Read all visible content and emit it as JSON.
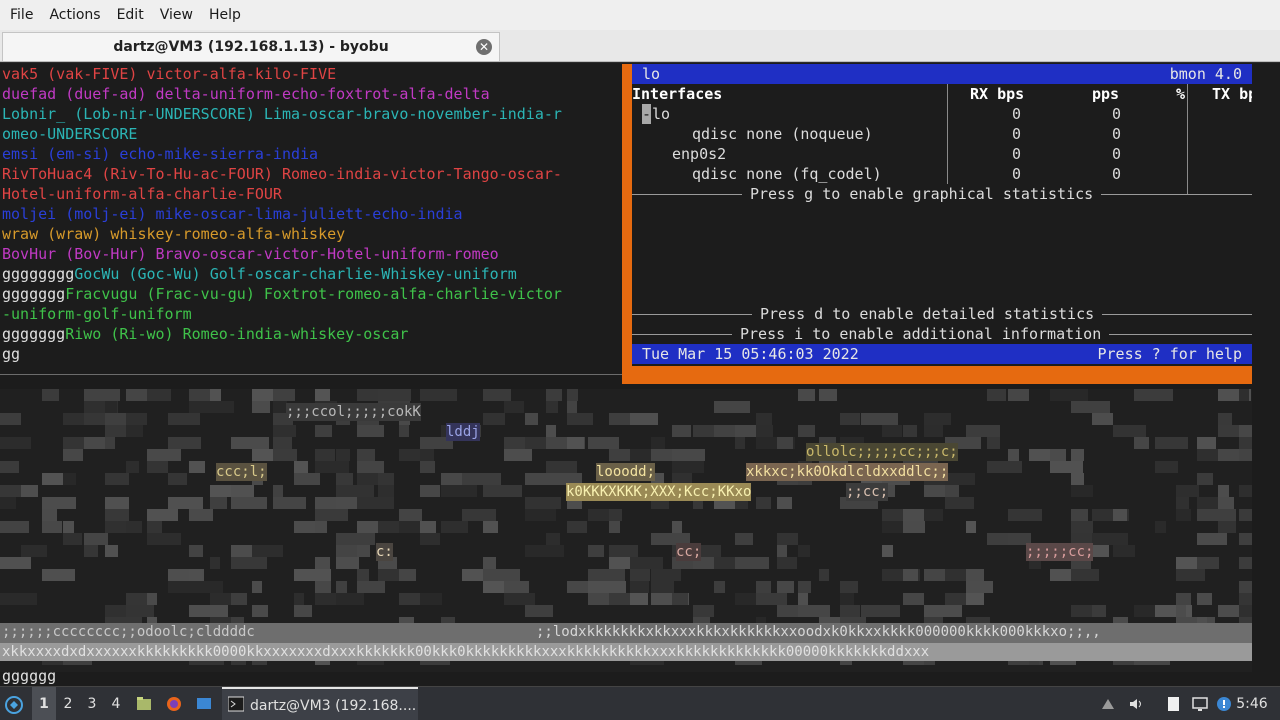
{
  "menubar": {
    "items": [
      "File",
      "Actions",
      "Edit",
      "View",
      "Help"
    ]
  },
  "tab": {
    "title": "dartz@VM3 (192.168.1.13) - byobu",
    "close_glyph": "✕"
  },
  "left_pane": {
    "lines": [
      {
        "text": "vak5 (vak-FIVE) victor-alfa-kilo-FIVE",
        "color": "#e04444"
      },
      {
        "text": "duefad (duef-ad) delta-uniform-echo-foxtrot-alfa-delta",
        "color": "#c13ac4"
      },
      {
        "text": "Lobnir_ (Lob-nir-UNDERSCORE) Lima-oscar-bravo-november-india-r",
        "color": "#2bb5b5"
      },
      {
        "text": "omeo-UNDERSCORE",
        "color": "#2bb5b5"
      },
      {
        "text": "emsi (em-si) echo-mike-sierra-india",
        "color": "#2a3fd8"
      },
      {
        "text": "RivToHuac4 (Riv-To-Hu-ac-FOUR) Romeo-india-victor-Tango-oscar-",
        "color": "#e04444"
      },
      {
        "text": "Hotel-uniform-alfa-charlie-FOUR",
        "color": "#e04444"
      },
      {
        "text": "moljei (molj-ei) mike-oscar-lima-juliett-echo-india",
        "color": "#2a3fd8"
      },
      {
        "text": "wraw (wraw) whiskey-romeo-alfa-whiskey",
        "color": "#d79a2a"
      },
      {
        "text": "BovHur (Bov-Hur) Bravo-oscar-victor-Hotel-uniform-romeo",
        "color": "#c13ac4"
      },
      {
        "text": "ggggggggGocWu (Goc-Wu) Golf-oscar-charlie-Whiskey-uniform",
        "color": "#2bb5b5",
        "prefix": "gggggggg"
      },
      {
        "text": "gggggggFracvugu (Frac-vu-gu) Foxtrot-romeo-alfa-charlie-victor",
        "color": "#3fc24a",
        "prefix": "ggggggg"
      },
      {
        "text": "-uniform-golf-uniform",
        "color": "#3fc24a"
      },
      {
        "text": "gggggggRiwo (Ri-wo) Romeo-india-whiskey-oscar",
        "color": "#3fc24a",
        "prefix": "ggggggg"
      },
      {
        "text": "gg",
        "color": "#e0e0e0"
      }
    ]
  },
  "bmon": {
    "interface_name": "lo",
    "version": "bmon 4.0",
    "columns": [
      "Interfaces",
      "RX bps",
      "pps",
      "%",
      "TX bp"
    ],
    "rows": [
      {
        "name": "lo",
        "indent": 0,
        "rx_bps": "0",
        "pps": "0",
        "selected": true
      },
      {
        "name": "qdisc none (noqueue)",
        "indent": 2,
        "rx_bps": "0",
        "pps": "0"
      },
      {
        "name": "enp0s2",
        "indent": 1,
        "rx_bps": "0",
        "pps": "0"
      },
      {
        "name": "qdisc none (fq_codel)",
        "indent": 2,
        "rx_bps": "0",
        "pps": "0"
      }
    ],
    "msg_graphical": "Press g to enable graphical statistics",
    "msg_detailed": "Press d to enable detailed statistics",
    "msg_additional": "Press i to enable additional information",
    "datetime": "Tue Mar 15 05:46:03 2022",
    "help_hint": "Press ? for help"
  },
  "ascii": {
    "lines": [
      {
        "text": ";;;ccol;;;;;cokK",
        "color": "#b8b8b8"
      },
      {
        "text": "lddj",
        "color": "#9aa3e6"
      },
      {
        "text": "ollolc;;;;;cc;;;c;",
        "color": "#c9b86a"
      },
      {
        "text": "ccc;l;",
        "color": "#d8c98a"
      },
      {
        "text": "looodd;",
        "color": "#f2e2a0"
      },
      {
        "text": "xkkxc;kk0Okdlcldxxddlc;;",
        "color": "#f2dfa0"
      },
      {
        "text": "k0KKKXKKK;XXX;Kcc;KKxo",
        "color": "#f7f0b0"
      },
      {
        "text": ";;cc;",
        "color": "#d9c0b0"
      },
      {
        "text": "c:",
        "color": "#e8d8b8"
      },
      {
        "text": "cc;",
        "color": "#d8a8a0"
      },
      {
        "text": ";;;;;cc;",
        "color": "#d89c9c"
      },
      {
        "text": ";;;;;;cccccccc;;odoolc;clddddc",
        "color": "#c8c8c8"
      },
      {
        "text": ";;lodxkkkkkkkxkkxxxkkkxkkkkkkxxoodxk0kkxxkkkk000000kkkk000kkkxo;;,,",
        "color": "#d6d6d6"
      },
      {
        "text": "xkkxxxxdxdxxxxxxkkkkkkkkk0000kkxxxxxxxdxxxkkkkkkk00kkk0kkkkkkkkkxxxkkkkkkkkkkxxxkkkkkkkkkkkkk00000kkkkkkkddxxx",
        "color": "#e0e0e0"
      }
    ]
  },
  "prompt": "gggggg",
  "taskbar": {
    "workspaces": [
      "1",
      "2",
      "3",
      "4"
    ],
    "active_workspace": "1",
    "task_label": "dartz@VM3 (192.168....",
    "clock": "5:46"
  }
}
